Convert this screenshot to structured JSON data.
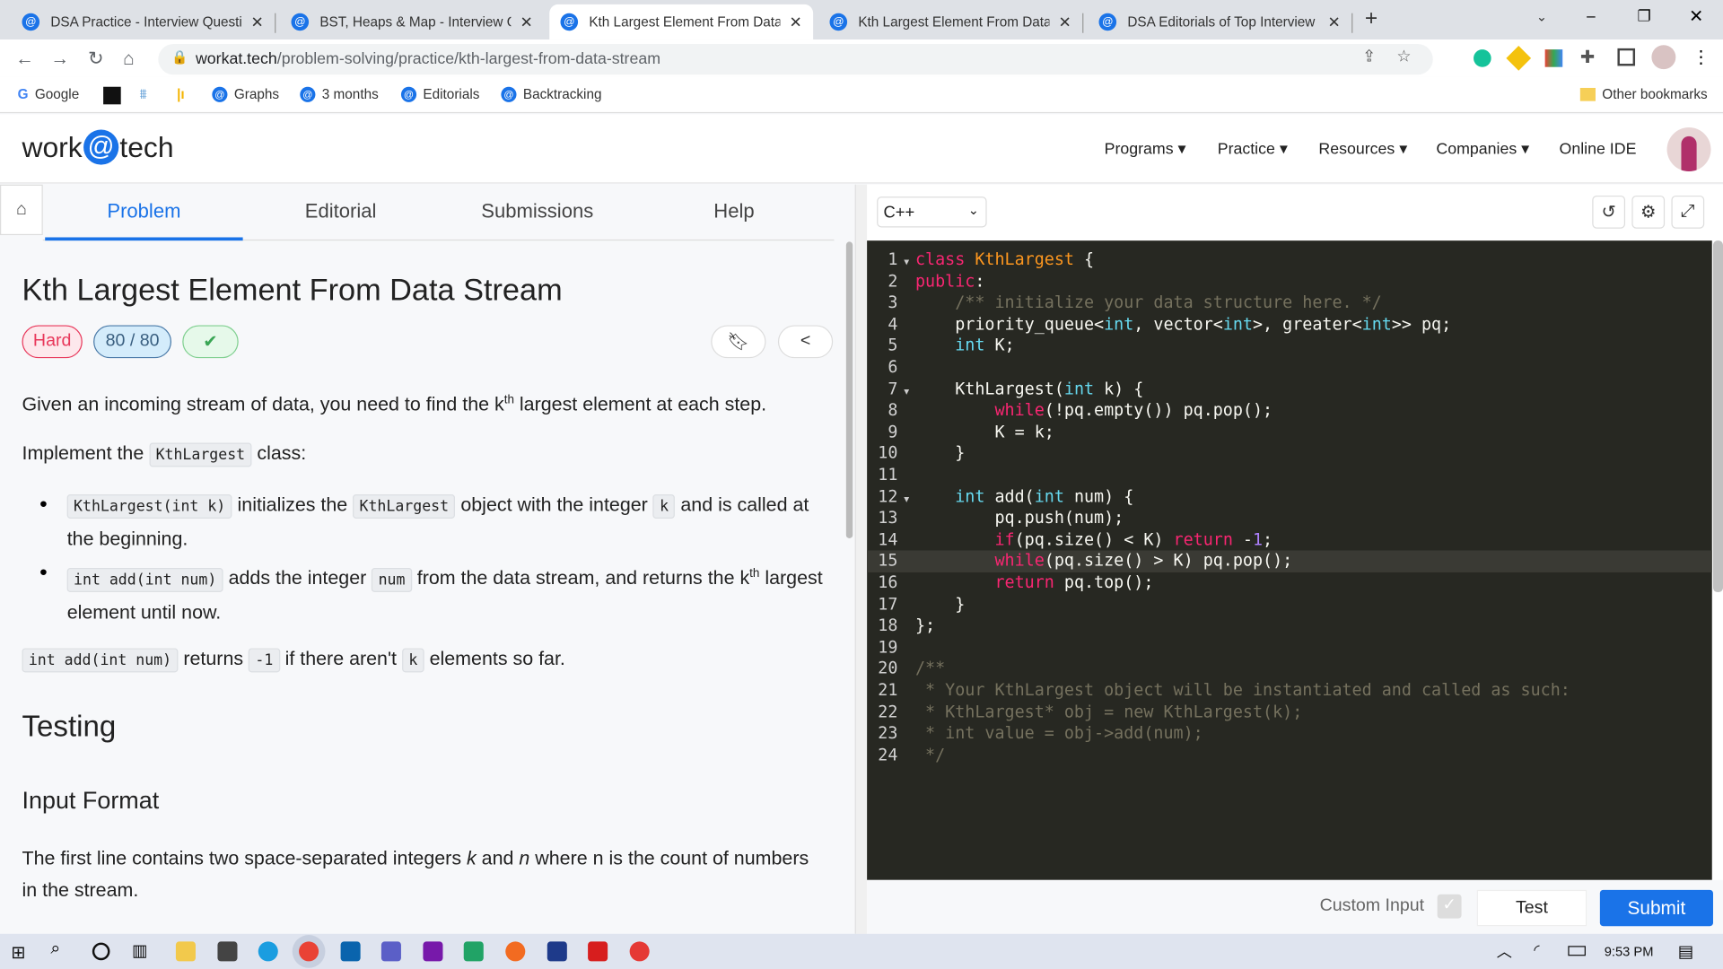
{
  "browser": {
    "tabs": [
      {
        "title": "DSA Practice - Interview Questions",
        "active": false
      },
      {
        "title": "BST, Heaps & Map - Interview Questions",
        "active": false
      },
      {
        "title": "Kth Largest Element From Data Stream",
        "active": true
      },
      {
        "title": "Kth Largest Element From Data Stream",
        "active": false
      },
      {
        "title": "DSA Editorials of Top Interview Questions",
        "active": false
      }
    ],
    "url_host": "workat.tech",
    "url_path": "/problem-solving/practice/kth-largest-from-data-stream",
    "bookmarks": [
      "Google",
      "",
      "",
      "",
      "Graphs",
      "3 months",
      "Editorials",
      "Backtracking"
    ],
    "other_bookmarks": "Other bookmarks"
  },
  "site": {
    "logo": {
      "pre": "work",
      "at": "@",
      "post": "tech"
    },
    "nav": [
      "Programs",
      "Practice",
      "Resources",
      "Companies",
      "Online IDE"
    ]
  },
  "problem": {
    "tabs": [
      "Problem",
      "Editorial",
      "Submissions",
      "Help"
    ],
    "title": "Kth Largest Element From Data Stream",
    "difficulty": "Hard",
    "score": "80 / 80",
    "solved": true,
    "p1a": "Given an incoming stream of data, you need to find the k",
    "p1sup": "th",
    "p1b": " largest element at each step.",
    "p2a": "Implement the ",
    "p2code": "KthLargest",
    "p2b": " class:",
    "b1code1": "KthLargest(int k)",
    "b1a": " initializes the ",
    "b1code2": "KthLargest",
    "b1b": " object with the integer ",
    "b1code3": "k",
    "b1c": " and is called at the beginning.",
    "b2code1": "int add(int num)",
    "b2a": " adds the integer ",
    "b2code2": "num",
    "b2b": " from the data stream, and returns the k",
    "b2sup": "th",
    "b2c": " largest element until now.",
    "p3code1": "int add(int num)",
    "p3a": " returns ",
    "p3code2": "-1",
    "p3b": " if there aren't ",
    "p3code3": "k",
    "p3c": " elements so far.",
    "h_testing": "Testing",
    "h_input": "Input Format",
    "input_a": "The first line contains two space-separated integers ",
    "input_k": "k",
    "input_b": " and ",
    "input_n": "n",
    "input_c": " where n is the count of numbers in the stream."
  },
  "editor": {
    "language": "C++",
    "highlighted_line": 15,
    "lines": [
      [
        [
          "class ",
          "kw"
        ],
        [
          "KthLargest",
          "cls"
        ],
        [
          " {",
          ""
        ]
      ],
      [
        [
          "public",
          "kw"
        ],
        [
          ":",
          ""
        ]
      ],
      [
        [
          "    /** initialize your data structure here. */",
          "cm"
        ]
      ],
      [
        [
          "    priority_queue<",
          ""
        ],
        [
          "int",
          "ty"
        ],
        [
          ", vector<",
          ""
        ],
        [
          "int",
          "ty"
        ],
        [
          ">, greater<",
          ""
        ],
        [
          "int",
          "ty"
        ],
        [
          ">> pq;",
          ""
        ]
      ],
      [
        [
          "    ",
          ""
        ],
        [
          "int",
          "ty"
        ],
        [
          " K;",
          ""
        ]
      ],
      [],
      [
        [
          "    KthLargest(",
          ""
        ],
        [
          "int",
          "ty"
        ],
        [
          " k) {",
          ""
        ]
      ],
      [
        [
          "        ",
          ""
        ],
        [
          "while",
          "kw"
        ],
        [
          "(!pq.empty()) pq.pop();",
          ""
        ]
      ],
      [
        [
          "        K = k;",
          ""
        ]
      ],
      [
        [
          "    }",
          ""
        ]
      ],
      [],
      [
        [
          "    ",
          ""
        ],
        [
          "int",
          "ty"
        ],
        [
          " add(",
          ""
        ],
        [
          "int",
          "ty"
        ],
        [
          " num) {",
          ""
        ]
      ],
      [
        [
          "        pq.push(num);",
          ""
        ]
      ],
      [
        [
          "        ",
          ""
        ],
        [
          "if",
          "kw"
        ],
        [
          "(pq.size() < K) ",
          ""
        ],
        [
          "return",
          "kw"
        ],
        [
          " -",
          ""
        ],
        [
          "1",
          "nm"
        ],
        [
          ";",
          ""
        ]
      ],
      [
        [
          "        ",
          ""
        ],
        [
          "while",
          "kw"
        ],
        [
          "(pq.size() > K) pq.pop();",
          ""
        ]
      ],
      [
        [
          "        ",
          ""
        ],
        [
          "return",
          "kw"
        ],
        [
          " pq.top();",
          ""
        ]
      ],
      [
        [
          "    }",
          ""
        ]
      ],
      [
        [
          "};",
          ""
        ]
      ],
      [],
      [
        [
          "/**",
          "cm"
        ]
      ],
      [
        [
          " * Your KthLargest object will be instantiated and called as such:",
          "cm"
        ]
      ],
      [
        [
          " * KthLargest* obj = new KthLargest(k);",
          "cm"
        ]
      ],
      [
        [
          " * int value = obj->add(num);",
          "cm"
        ]
      ],
      [
        [
          " */",
          "cm"
        ]
      ]
    ],
    "fold_lines": [
      1,
      7,
      12
    ],
    "custom_input_label": "Custom Input",
    "test_label": "Test",
    "submit_label": "Submit"
  },
  "taskbar": {
    "time": "9:53 PM"
  },
  "colors": {
    "accent": "#1a73e8",
    "hard": "#e8375a",
    "editor_bg": "#272822"
  }
}
